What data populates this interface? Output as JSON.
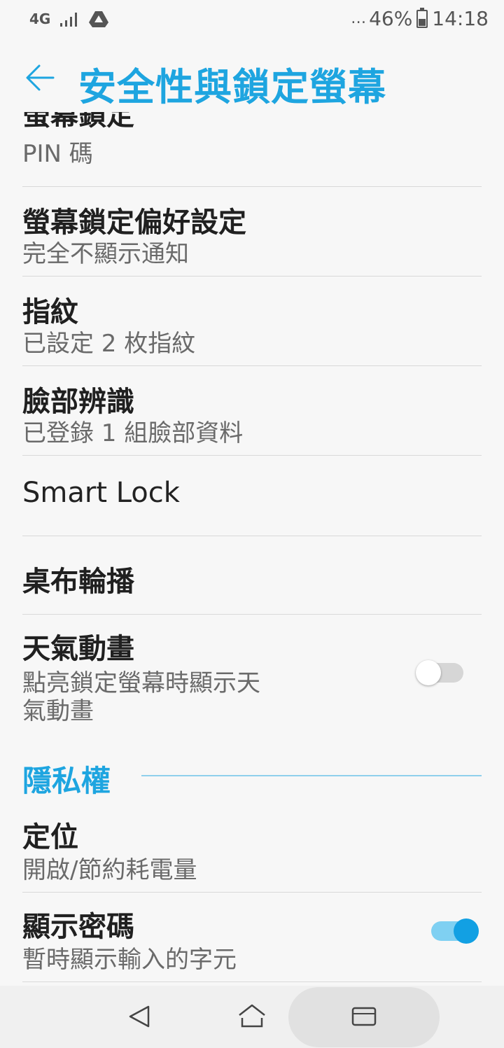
{
  "status_bar": {
    "network": "4G",
    "battery": "46%",
    "time": "14:18",
    "icons": [
      "signal-icon",
      "drive-icon",
      "battery-icon"
    ]
  },
  "app_bar": {
    "title": "安全性與鎖定螢幕"
  },
  "items": [
    {
      "primary": "螢幕鎖定",
      "secondary": "PIN 碼"
    },
    {
      "primary": "螢幕鎖定偏好設定",
      "secondary": "完全不顯示通知"
    },
    {
      "primary": "指紋",
      "secondary": "已設定 2 枚指紋"
    },
    {
      "primary": "臉部辨識",
      "secondary": "已登錄 1 組臉部資料"
    },
    {
      "primary": "Smart Lock"
    },
    {
      "primary": "桌布輪播"
    },
    {
      "primary": "天氣動畫",
      "secondary_line1": "點亮鎖定螢幕時顯示天",
      "secondary_line2": "氣動畫",
      "toggle": "off"
    }
  ],
  "privacy_section": {
    "header": "隱私權",
    "items": [
      {
        "primary": "定位",
        "secondary": "開啟/節約耗電量"
      },
      {
        "primary": "顯示密碼",
        "secondary": "暫時顯示輸入的字元",
        "toggle": "on"
      }
    ]
  },
  "colors": {
    "accent": "#1ea5e0",
    "toggle_on": "#12a0e3",
    "background": "#f7f7f7"
  }
}
